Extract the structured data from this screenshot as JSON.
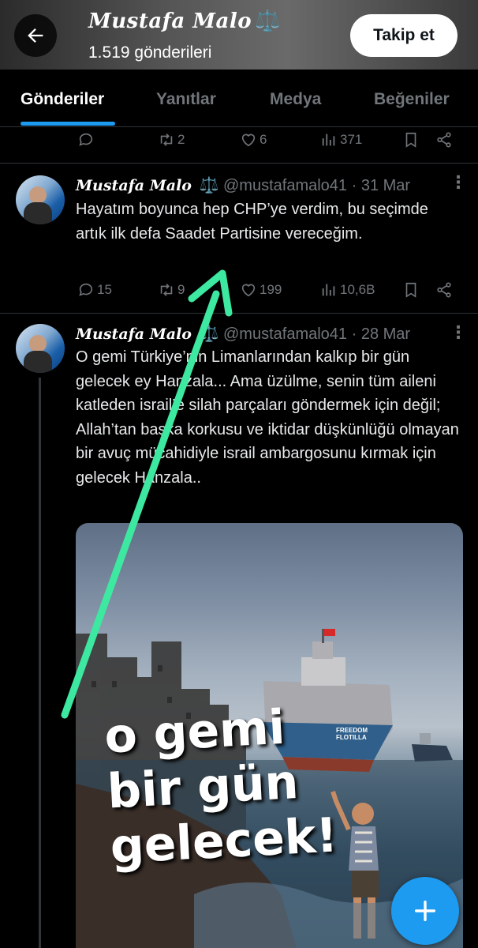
{
  "header": {
    "back_label": "←",
    "profile_name": "Mustafa Malo",
    "profile_badge": "⚖️",
    "post_count": "1.519 gönderileri",
    "follow_label": "Takip et"
  },
  "tabs": [
    "Gönderiler",
    "Yanıtlar",
    "Medya",
    "Beğeniler"
  ],
  "prev_tweet_actions": {
    "retweets": "2",
    "likes": "6",
    "views": "371"
  },
  "tweets": [
    {
      "name": "Mustafa Malo",
      "badge": "⚖️",
      "meta": "@mustafamalo41 · 31 Mar",
      "text": "Hayatım boyunca hep CHP’ye verdim, bu seçimde artık ilk defa Saadet Partisine vereceğim.",
      "replies": "15",
      "retweets": "9",
      "likes": "199",
      "views": "10,6B"
    },
    {
      "name": "Mustafa Malo",
      "badge": "⚖️",
      "meta": "@mustafamalo41 · 28 Mar",
      "text": "O gemi Türkiye’nin Limanlarından kalkıp bir gün gelecek ey Hanzala... Ama üzülme, senin tüm aileni katleden israil’e silah parçaları göndermek için değil; Allah’tan başka korkusu ve iktidar düşkünlüğü olmayan bir avuç mücahidiyle israil ambargosunu kırmak için gelecek Hanzala..",
      "media_lines": [
        "o gemi",
        "bir gün",
        "gelecek!"
      ],
      "ship_label": "FREEDOM FLOTILLA"
    }
  ],
  "fab_label": "+",
  "colors": {
    "accent": "#1d9bf0",
    "arrow": "#3de8a0",
    "muted": "#71767b",
    "background": "#000000"
  },
  "icons": [
    "back-arrow-icon",
    "reply-icon",
    "retweet-icon",
    "heart-icon",
    "views-icon",
    "bookmark-icon",
    "share-icon",
    "more-icon",
    "plus-icon"
  ]
}
